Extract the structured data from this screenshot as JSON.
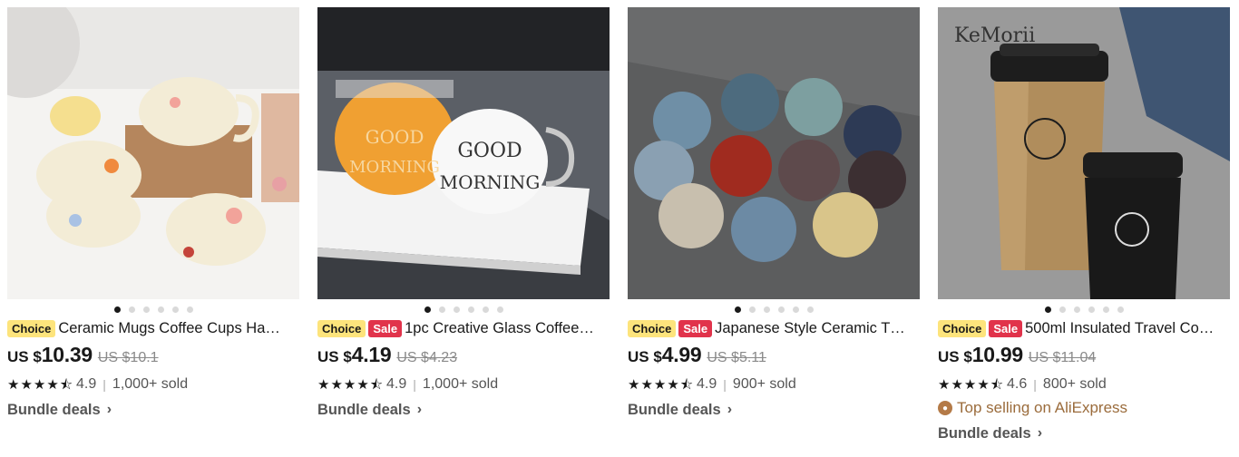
{
  "products": [
    {
      "badges": [
        "Choice"
      ],
      "title": "Ceramic Mugs Coffee Cups Ha…",
      "currency": "US $",
      "price": "10.39",
      "old_price": "US $10.1",
      "rating": "4.9",
      "sold": "1,000+ sold",
      "top_selling": "",
      "bundle": "Bundle deals"
    },
    {
      "badges": [
        "Choice",
        "Sale"
      ],
      "title": "1pc Creative Glass Coffee…",
      "currency": "US $",
      "price": "4.19",
      "old_price": "US $4.23",
      "rating": "4.9",
      "sold": "1,000+ sold",
      "top_selling": "",
      "bundle": "Bundle deals"
    },
    {
      "badges": [
        "Choice",
        "Sale"
      ],
      "title": "Japanese Style Ceramic T…",
      "currency": "US $",
      "price": "4.99",
      "old_price": "US $5.11",
      "rating": "4.9",
      "sold": "900+ sold",
      "top_selling": "",
      "bundle": "Bundle deals"
    },
    {
      "badges": [
        "Choice",
        "Sale"
      ],
      "title": "500ml Insulated Travel Co…",
      "currency": "US $",
      "price": "10.99",
      "old_price": "US $11.04",
      "rating": "4.6",
      "sold": "800+ sold",
      "top_selling": "Top selling on AliExpress",
      "bundle": "Bundle deals",
      "image_brand": "KeMorii"
    }
  ],
  "image_dot_count": 6,
  "image_dot_active": 0,
  "colors": {
    "choice": "#fde47c",
    "sale": "#e1334b",
    "top": "#9b6c3c"
  }
}
